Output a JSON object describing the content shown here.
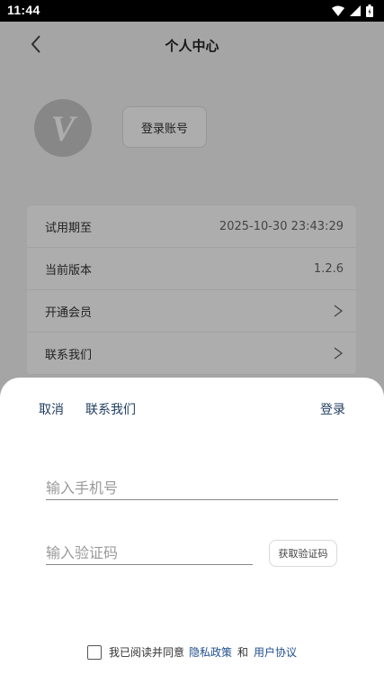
{
  "status_bar": {
    "time": "11:44"
  },
  "header": {
    "title": "个人中心",
    "back_icon": "chevron-left-icon"
  },
  "profile": {
    "avatar_letter": "V",
    "login_button": "登录账号"
  },
  "info_rows": [
    {
      "label": "试用期至",
      "value": "2025-10-30 23:43:29"
    },
    {
      "label": "当前版本",
      "value": "1.2.6"
    },
    {
      "label": "开通会员",
      "value": ">"
    },
    {
      "label": "联系我们",
      "value": ">"
    }
  ],
  "sheet": {
    "cancel": "取消",
    "contact": "联系我们",
    "login": "登录",
    "phone_placeholder": "输入手机号",
    "code_placeholder": "输入验证码",
    "get_code": "获取验证码",
    "agree_text": "我已阅读并同意",
    "privacy_link": "隐私政策",
    "and_text": "和",
    "user_agreement_link": "用户协议"
  },
  "colors": {
    "accent": "#1f3c5e",
    "overlay": "rgba(0,0,0,0.32)"
  }
}
